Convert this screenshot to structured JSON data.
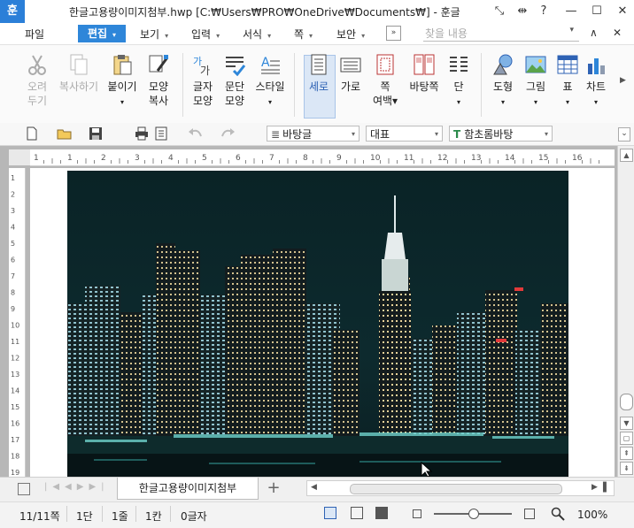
{
  "app": {
    "logo_char": "훈",
    "title": "한글고용량이미지첨부.hwp [C:₩Users₩PRO₩OneDrive₩Documents₩] - 훈글"
  },
  "window_buttons": {
    "resize_glyph": "⤡",
    "split_glyph": "⇹",
    "help": "?",
    "minimize": "—",
    "maximize": "☐",
    "close": "✕"
  },
  "menu": {
    "items": [
      {
        "label": "파일",
        "arrow": ""
      },
      {
        "label": "편집",
        "arrow": "▾"
      },
      {
        "label": "보기",
        "arrow": "▾"
      },
      {
        "label": "입력",
        "arrow": "▾"
      },
      {
        "label": "서식",
        "arrow": "▾"
      },
      {
        "label": "쪽",
        "arrow": "▾"
      },
      {
        "label": "보안",
        "arrow": "▾"
      }
    ],
    "expand": "»",
    "find_placeholder": "찾을 내용",
    "find_arrow": "▾",
    "collapse": "∧",
    "close": "✕"
  },
  "ribbon": {
    "buttons": [
      {
        "line1": "오려",
        "line2": "두기",
        "disabled": true,
        "icon": "scissors-icon"
      },
      {
        "line1": "복사하기",
        "line2": "",
        "disabled": true,
        "icon": "copy-icon"
      },
      {
        "line1": "붙이기",
        "line2": "▾",
        "disabled": false,
        "icon": "paste-icon"
      },
      {
        "line1": "모양",
        "line2": "복사",
        "disabled": false,
        "icon": "format-painter-icon"
      },
      {
        "line1": "글자",
        "line2": "모양",
        "disabled": false,
        "icon": "char-shape-icon"
      },
      {
        "line1": "문단",
        "line2": "모양",
        "disabled": false,
        "icon": "para-shape-icon"
      },
      {
        "line1": "스타일",
        "line2": "▾",
        "disabled": false,
        "icon": "style-icon"
      },
      {
        "line1": "세로",
        "line2": "",
        "disabled": false,
        "icon": "portrait-icon",
        "active": true
      },
      {
        "line1": "가로",
        "line2": "",
        "disabled": false,
        "icon": "landscape-icon"
      },
      {
        "line1": "쪽",
        "line2": "여백▾",
        "disabled": false,
        "icon": "page-margin-icon"
      },
      {
        "line1": "바탕쪽",
        "line2": "",
        "disabled": false,
        "icon": "master-page-icon"
      },
      {
        "line1": "단",
        "line2": "▾",
        "disabled": false,
        "icon": "columns-icon"
      },
      {
        "line1": "도형",
        "line2": "▾",
        "disabled": false,
        "icon": "shapes-icon"
      },
      {
        "line1": "그림",
        "line2": "▾",
        "disabled": false,
        "icon": "picture-icon"
      },
      {
        "line1": "표",
        "line2": "▾",
        "disabled": false,
        "icon": "table-icon"
      },
      {
        "line1": "차트",
        "line2": "▾",
        "disabled": false,
        "icon": "chart-icon"
      }
    ],
    "scroll_right": "▶"
  },
  "toolbar": {
    "style_combo": "바탕글",
    "lang_combo": "대표",
    "font_combo": "함초롬바탕",
    "font_glyph": "T",
    "dropdown": "▾",
    "more": "⌄"
  },
  "ruler": {
    "h_ticks": [
      "1",
      "1",
      "2",
      "3",
      "4",
      "5",
      "6",
      "7",
      "8",
      "9",
      "10",
      "11",
      "12",
      "13",
      "14",
      "15",
      "16"
    ],
    "v_ticks": [
      "1",
      "2",
      "3",
      "4",
      "5",
      "6",
      "7",
      "8",
      "9",
      "10",
      "11",
      "12",
      "13",
      "14",
      "15",
      "16",
      "17",
      "18",
      "19"
    ]
  },
  "tabs": {
    "doc_tab": "한글고용량이미지첨부",
    "add": "+"
  },
  "status": {
    "page": "11/11쪽",
    "section": "1단",
    "line": "1줄",
    "column": "1칸",
    "chars": "0글자",
    "zoom": "100%",
    "zoom_fraction": 0.5
  }
}
